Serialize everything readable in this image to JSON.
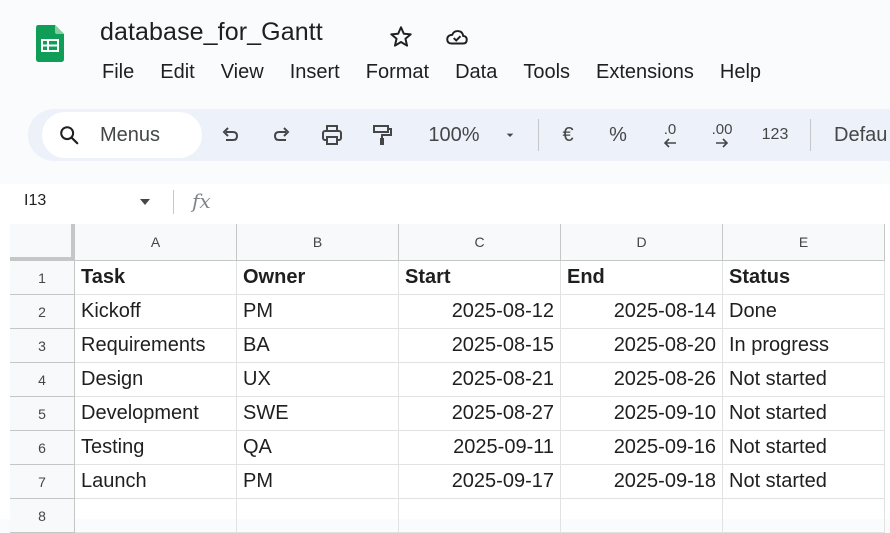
{
  "header": {
    "title": "database_for_Gantt",
    "menus": [
      "File",
      "Edit",
      "View",
      "Insert",
      "Format",
      "Data",
      "Tools",
      "Extensions",
      "Help"
    ]
  },
  "toolbar": {
    "search_label": "Menus",
    "zoom": "100%",
    "currency": "€",
    "percent": "%",
    "decrease_decimal": ".0",
    "increase_decimal": ".00",
    "number_format": "123",
    "font": "Defau"
  },
  "formula_bar": {
    "name_box": "I13",
    "fx": "fx"
  },
  "grid": {
    "columns": [
      "A",
      "B",
      "C",
      "D",
      "E"
    ],
    "rows": [
      "1",
      "2",
      "3",
      "4",
      "5",
      "6",
      "7",
      "8"
    ],
    "cells": [
      [
        "Task",
        "Owner",
        "Start",
        "End",
        "Status"
      ],
      [
        "Kickoff",
        "PM",
        "2025-08-12",
        "2025-08-14",
        "Done"
      ],
      [
        "Requirements",
        "BA",
        "2025-08-15",
        "2025-08-20",
        "In progress"
      ],
      [
        "Design",
        "UX",
        "2025-08-21",
        "2025-08-26",
        "Not started"
      ],
      [
        "Development",
        "SWE",
        "2025-08-27",
        "2025-09-10",
        "Not started"
      ],
      [
        "Testing",
        "QA",
        "2025-09-11",
        "2025-09-16",
        "Not started"
      ],
      [
        "Launch",
        "PM",
        "2025-09-17",
        "2025-09-18",
        "Not started"
      ],
      [
        "",
        "",
        "",
        "",
        ""
      ]
    ]
  },
  "colors": {
    "sheets_green": "#0f9d58",
    "toolbar_bg": "#edf2fa",
    "header_bg": "#f8f9fa"
  }
}
